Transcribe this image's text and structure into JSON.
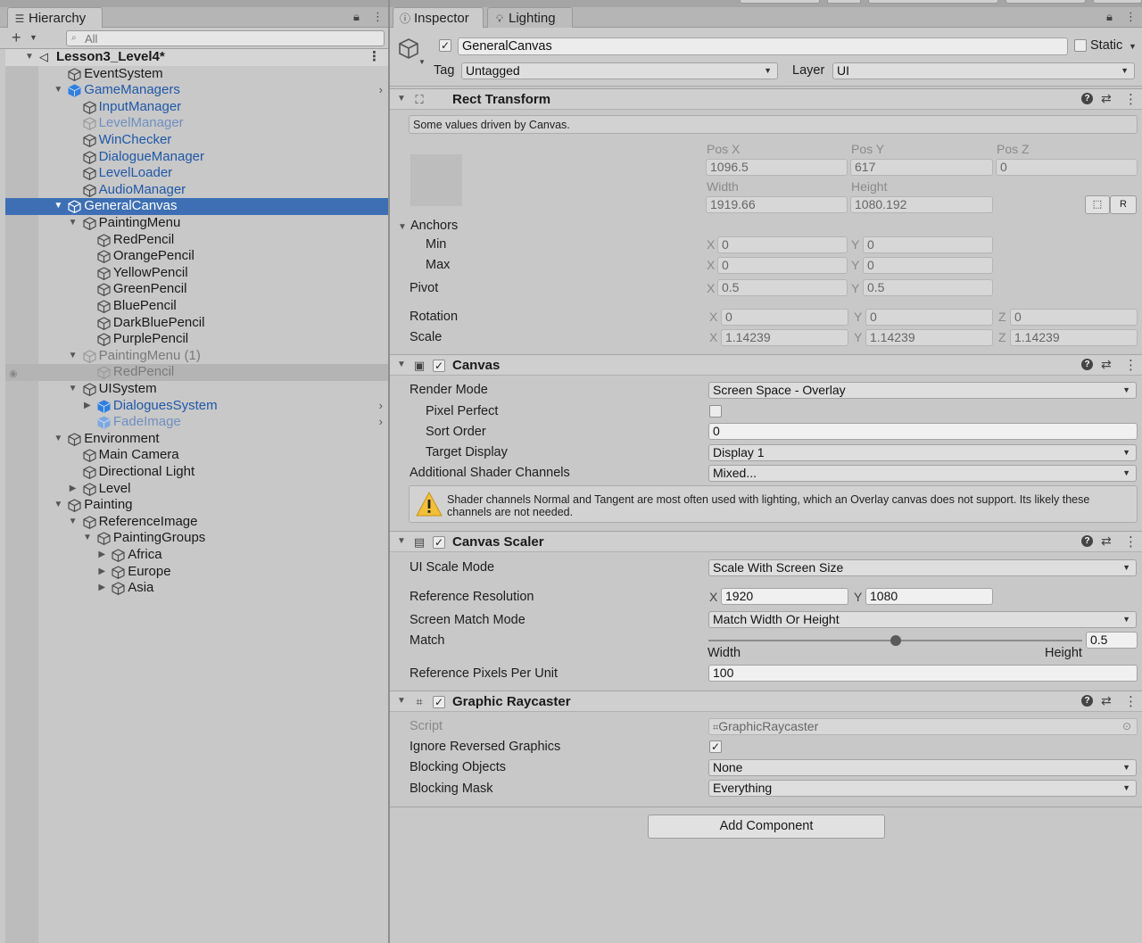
{
  "hierarchy": {
    "tab_label": "Hierarchy",
    "search_placeholder": "All",
    "rows": [
      {
        "label": "Lesson3_Level4*",
        "depth": 0,
        "arrow": "down",
        "kind": "scene"
      },
      {
        "label": "EventSystem",
        "depth": 1,
        "arrow": "",
        "kind": "normal"
      },
      {
        "label": "GameManagers",
        "depth": 1,
        "arrow": "down",
        "kind": "prefab",
        "chev": true
      },
      {
        "label": "InputManager",
        "depth": 2,
        "arrow": "",
        "kind": "prefab"
      },
      {
        "label": "LevelManager",
        "depth": 2,
        "arrow": "",
        "kind": "prefab-inact"
      },
      {
        "label": "WinChecker",
        "depth": 2,
        "arrow": "",
        "kind": "prefab"
      },
      {
        "label": "DialogueManager",
        "depth": 2,
        "arrow": "",
        "kind": "prefab"
      },
      {
        "label": "LevelLoader",
        "depth": 2,
        "arrow": "",
        "kind": "prefab"
      },
      {
        "label": "AudioManager",
        "depth": 2,
        "arrow": "",
        "kind": "prefab"
      },
      {
        "label": "GeneralCanvas",
        "depth": 1,
        "arrow": "down",
        "kind": "selected"
      },
      {
        "label": "PaintingMenu",
        "depth": 2,
        "arrow": "down",
        "kind": "normal"
      },
      {
        "label": "RedPencil",
        "depth": 3,
        "arrow": "",
        "kind": "normal"
      },
      {
        "label": "OrangePencil",
        "depth": 3,
        "arrow": "",
        "kind": "normal"
      },
      {
        "label": "YellowPencil",
        "depth": 3,
        "arrow": "",
        "kind": "normal"
      },
      {
        "label": "GreenPencil",
        "depth": 3,
        "arrow": "",
        "kind": "normal"
      },
      {
        "label": "BluePencil",
        "depth": 3,
        "arrow": "",
        "kind": "normal"
      },
      {
        "label": "DarkBluePencil",
        "depth": 3,
        "arrow": "",
        "kind": "normal"
      },
      {
        "label": "PurplePencil",
        "depth": 3,
        "arrow": "",
        "kind": "normal"
      },
      {
        "label": "PaintingMenu (1)",
        "depth": 2,
        "arrow": "down",
        "kind": "inact"
      },
      {
        "label": "RedPencil",
        "depth": 3,
        "arrow": "",
        "kind": "inact-hl"
      },
      {
        "label": "UISystem",
        "depth": 2,
        "arrow": "down",
        "kind": "normal"
      },
      {
        "label": "DialoguesSystem",
        "depth": 3,
        "arrow": "right",
        "kind": "prefab-solid",
        "chev": true
      },
      {
        "label": "FadeImage",
        "depth": 3,
        "arrow": "",
        "kind": "prefab-inact-solid",
        "chev": true
      },
      {
        "label": "Environment",
        "depth": 1,
        "arrow": "down",
        "kind": "normal"
      },
      {
        "label": "Main Camera",
        "depth": 2,
        "arrow": "",
        "kind": "normal"
      },
      {
        "label": "Directional Light",
        "depth": 2,
        "arrow": "",
        "kind": "normal"
      },
      {
        "label": "Level",
        "depth": 2,
        "arrow": "right",
        "kind": "normal"
      },
      {
        "label": "Painting",
        "depth": 1,
        "arrow": "down",
        "kind": "normal"
      },
      {
        "label": "ReferenceImage",
        "depth": 2,
        "arrow": "down",
        "kind": "normal"
      },
      {
        "label": "PaintingGroups",
        "depth": 3,
        "arrow": "down",
        "kind": "normal"
      },
      {
        "label": "Africa",
        "depth": 4,
        "arrow": "right",
        "kind": "normal"
      },
      {
        "label": "Europe",
        "depth": 4,
        "arrow": "right",
        "kind": "normal"
      },
      {
        "label": "Asia",
        "depth": 4,
        "arrow": "right",
        "kind": "normal"
      }
    ]
  },
  "inspector": {
    "tab_inspector": "Inspector",
    "tab_lighting": "Lighting",
    "object_name": "GeneralCanvas",
    "static_label": "Static",
    "tag_label": "Tag",
    "tag_value": "Untagged",
    "layer_label": "Layer",
    "layer_value": "UI",
    "rect_transform": {
      "title": "Rect Transform",
      "driven_note": "Some values driven by Canvas.",
      "pos_x_label": "Pos X",
      "pos_y_label": "Pos Y",
      "pos_z_label": "Pos Z",
      "pos_x": "1096.5",
      "pos_y": "617",
      "pos_z": "0",
      "width_label": "Width",
      "height_label": "Height",
      "width": "1919.66",
      "height": "1080.192",
      "raw_btn": "R",
      "anchors_label": "Anchors",
      "min_label": "Min",
      "max_label": "Max",
      "min_x": "0",
      "min_y": "0",
      "max_x": "0",
      "max_y": "0",
      "pivot_label": "Pivot",
      "pivot_x": "0.5",
      "pivot_y": "0.5",
      "rotation_label": "Rotation",
      "rot_x": "0",
      "rot_y": "0",
      "rot_z": "0",
      "scale_label": "Scale",
      "scale_x": "1.14239",
      "scale_y": "1.14239",
      "scale_z": "1.14239",
      "axis_x": "X",
      "axis_y": "Y",
      "axis_z": "Z"
    },
    "canvas": {
      "title": "Canvas",
      "render_mode_label": "Render Mode",
      "render_mode": "Screen Space - Overlay",
      "pixel_perfect_label": "Pixel Perfect",
      "sort_order_label": "Sort Order",
      "sort_order": "0",
      "target_display_label": "Target Display",
      "target_display": "Display 1",
      "shader_channels_label": "Additional Shader Channels",
      "shader_channels": "Mixed...",
      "warning": "Shader channels Normal and Tangent are most often used with lighting, which an Overlay canvas does not support. Its likely these channels are not needed."
    },
    "canvas_scaler": {
      "title": "Canvas Scaler",
      "ui_scale_mode_label": "UI Scale Mode",
      "ui_scale_mode": "Scale With Screen Size",
      "ref_res_label": "Reference Resolution",
      "ref_x": "1920",
      "ref_y": "1080",
      "match_mode_label": "Screen Match Mode",
      "match_mode": "Match Width Or Height",
      "match_label": "Match",
      "match_value": "0.5",
      "match_fraction": 0.5,
      "match_width_label": "Width",
      "match_height_label": "Height",
      "ref_ppu_label": "Reference Pixels Per Unit",
      "ref_ppu": "100"
    },
    "graphic_raycaster": {
      "title": "Graphic Raycaster",
      "script_label": "Script",
      "script_value": "GraphicRaycaster",
      "ignore_reversed_label": "Ignore Reversed Graphics",
      "blocking_objects_label": "Blocking Objects",
      "blocking_objects": "None",
      "blocking_mask_label": "Blocking Mask",
      "blocking_mask": "Everything"
    },
    "add_component": "Add Component"
  }
}
